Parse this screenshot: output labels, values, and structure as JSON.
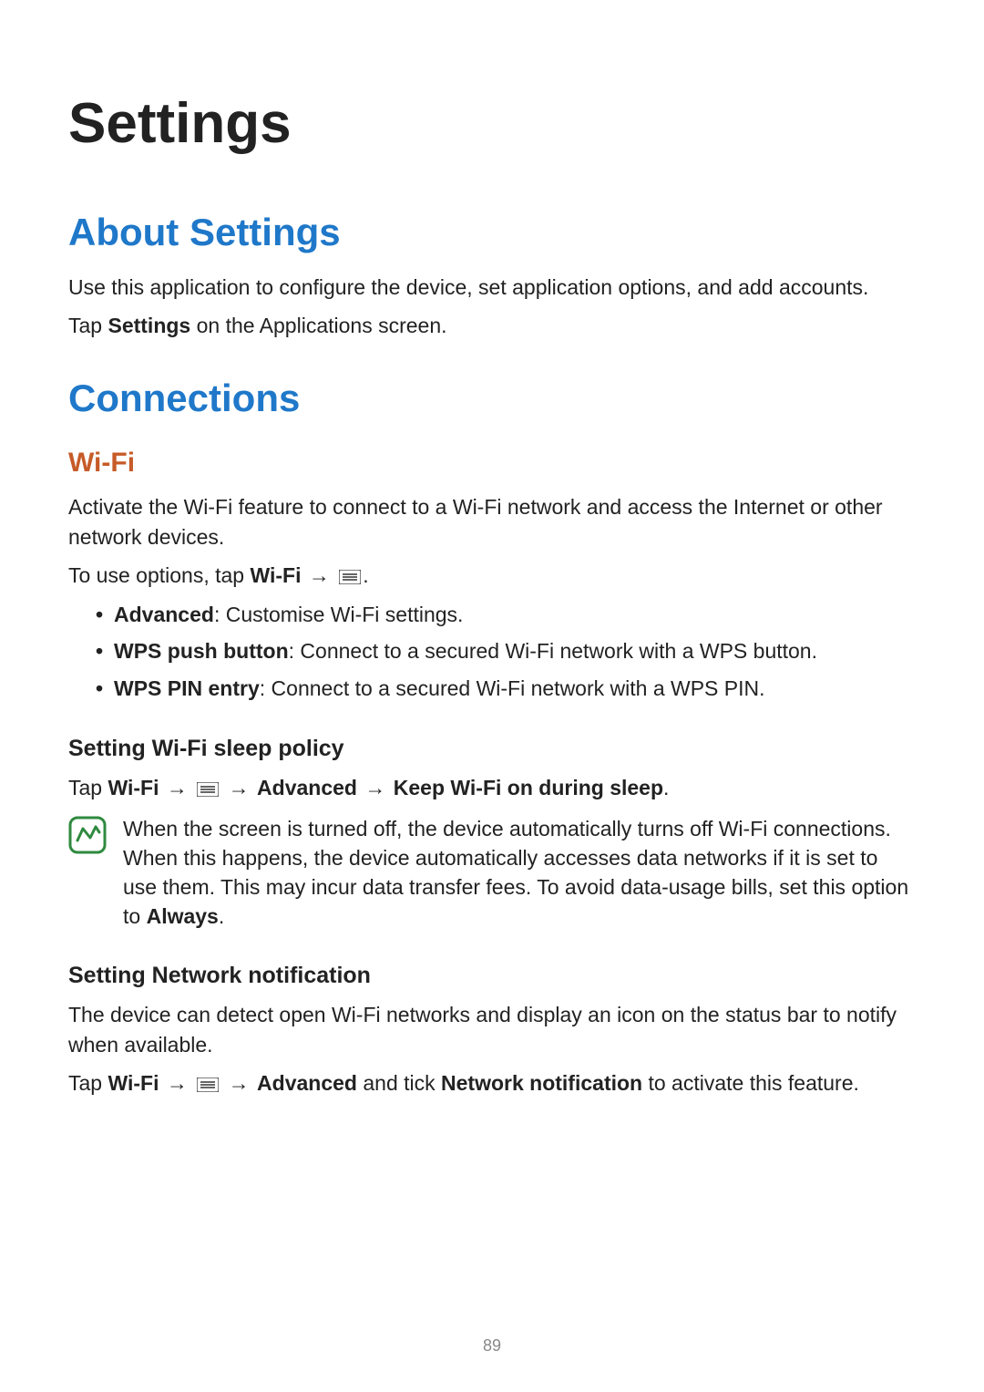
{
  "title": "Settings",
  "section_about": {
    "heading": "About Settings",
    "p1": "Use this application to configure the device, set application options, and add accounts.",
    "p2_pre": "Tap ",
    "p2_bold": "Settings",
    "p2_post": " on the Applications screen."
  },
  "section_conn": {
    "heading": "Connections",
    "wifi_heading": "Wi-Fi",
    "wifi_p1": "Activate the Wi-Fi feature to connect to a Wi-Fi network and access the Internet or other network devices.",
    "wifi_p2_pre": "To use options, tap ",
    "wifi_p2_bold": "Wi-Fi",
    "wifi_p2_post": ".",
    "bullets": [
      {
        "bold": "Advanced",
        "rest": ": Customise Wi-Fi settings."
      },
      {
        "bold": "WPS push button",
        "rest": ": Connect to a secured Wi-Fi network with a WPS button."
      },
      {
        "bold": "WPS PIN entry",
        "rest": ": Connect to a secured Wi-Fi network with a WPS PIN."
      }
    ],
    "sleep_heading": "Setting Wi-Fi sleep policy",
    "sleep_p_pre": "Tap ",
    "sleep_p_wifi": "Wi-Fi",
    "sleep_p_adv": "Advanced",
    "sleep_p_keep": "Keep Wi-Fi on during sleep",
    "sleep_p_post": ".",
    "note_text_pre": "When the screen is turned off, the device automatically turns off Wi-Fi connections. When this happens, the device automatically accesses data networks if it is set to use them. This may incur data transfer fees. To avoid data-usage bills, set this option to ",
    "note_text_bold": "Always",
    "note_text_post": ".",
    "netnotif_heading": "Setting Network notification",
    "netnotif_p1": "The device can detect open Wi-Fi networks and display an icon on the status bar to notify when available.",
    "netnotif_p2_pre": "Tap ",
    "netnotif_p2_wifi": "Wi-Fi",
    "netnotif_p2_adv": "Advanced",
    "netnotif_p2_mid": " and tick ",
    "netnotif_p2_nn": "Network notification",
    "netnotif_p2_post": " to activate this feature."
  },
  "arrow_glyph": "→",
  "page_number": "89"
}
